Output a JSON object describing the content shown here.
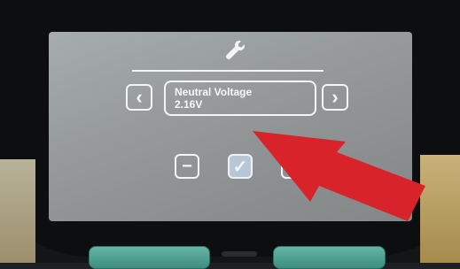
{
  "screen": {
    "title_icon": "wrench-icon",
    "nav": {
      "prev_glyph": "‹",
      "next_glyph": "›"
    },
    "setting": {
      "name": "Neutral Voltage",
      "value": "2.16V"
    },
    "actions": {
      "minus_glyph": "−",
      "confirm_glyph": "✓",
      "plus_glyph": "+"
    }
  },
  "colors": {
    "screen_bg": "#9a9ea0",
    "ui_white": "#f4f6f6",
    "confirm_fill": "#b7c7d6",
    "arrow_red": "#d8232a",
    "hardware_button": "#4fa394"
  }
}
